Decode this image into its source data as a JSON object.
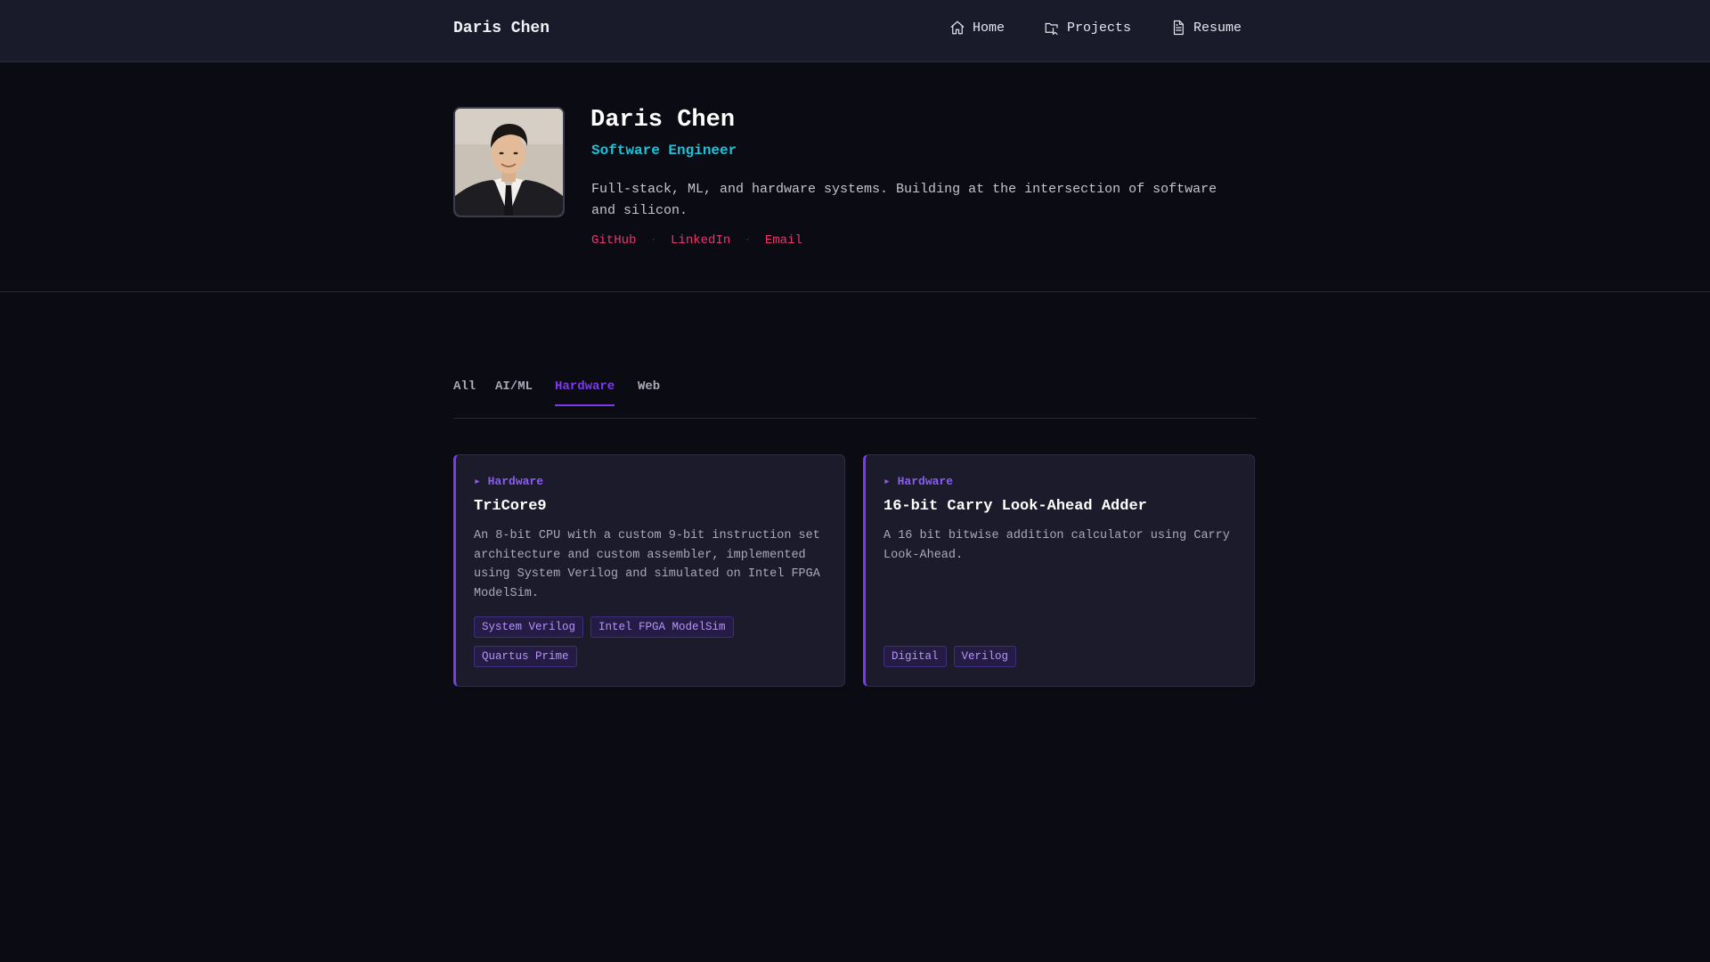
{
  "nav": {
    "brand": "Daris Chen",
    "links": [
      {
        "label": "Home",
        "icon": "home-icon"
      },
      {
        "label": "Projects",
        "icon": "projects-icon"
      },
      {
        "label": "Resume",
        "icon": "document-icon"
      }
    ]
  },
  "profile": {
    "name": "Daris Chen",
    "role": "Software Engineer",
    "bio": "Full-stack, ML, and hardware systems. Building at the intersection of software and silicon.",
    "links": [
      "GitHub",
      "LinkedIn",
      "Email"
    ],
    "separator": "·"
  },
  "tabs": [
    "All",
    "AI/ML",
    "Hardware",
    "Web"
  ],
  "active_tab": "Hardware",
  "projects": [
    {
      "category": "▸ Hardware",
      "title": "TriCore9",
      "description": "An 8-bit CPU with a custom 9-bit instruction set architecture and custom assembler, implemented using System Verilog and simulated on Intel FPGA ModelSim.",
      "tags": [
        "System Verilog",
        "Intel FPGA ModelSim",
        "Quartus Prime"
      ]
    },
    {
      "category": "▸ Hardware",
      "title": "16-bit Carry Look-Ahead Adder",
      "description": "A 16 bit bitwise addition calculator using Carry Look-Ahead.",
      "tags": [
        "Digital",
        "Verilog"
      ]
    }
  ],
  "colors": {
    "accent": "#7c3aed",
    "role": "#19c3d8",
    "link": "#e8366f",
    "background": "#0b0b13",
    "card": "#1b1b2c"
  }
}
